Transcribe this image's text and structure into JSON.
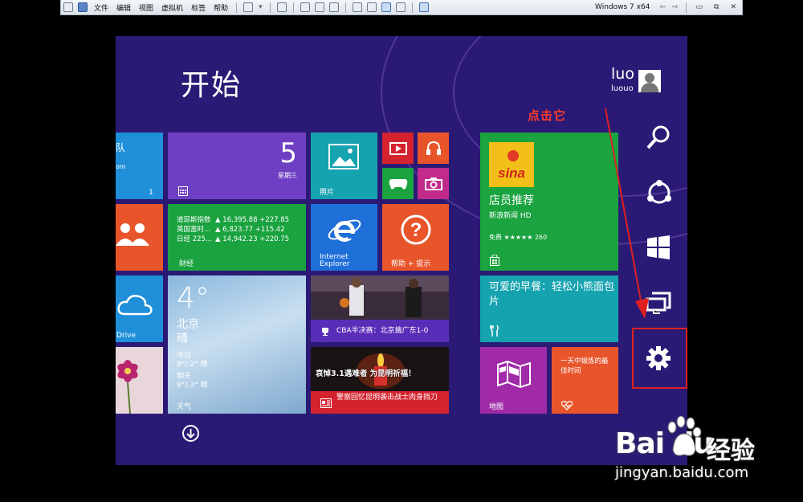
{
  "vm_toolbar": {
    "menus": [
      "文件",
      "编辑",
      "视图",
      "虚拟机",
      "标签",
      "帮助"
    ],
    "vm_name": "Windows 7 x64"
  },
  "start": {
    "title": "开始",
    "user": {
      "name": "luo",
      "account": "luouo"
    }
  },
  "tiles": {
    "left_partial_1": {
      "text": "队",
      "sub": "om",
      "count": "1"
    },
    "calendar": {
      "day": "5",
      "weekday": "星期三"
    },
    "photos": {
      "label": "照片"
    },
    "finance": {
      "label": "财经",
      "rows": [
        {
          "name": "道琼斯指数",
          "value": "▲ 16,395.88 +227.85"
        },
        {
          "name": "英国富时...",
          "value": "▲ 6,823.77 +115.42"
        },
        {
          "name": "日经 225...",
          "value": "▲ 14,942.23 +220.75"
        }
      ]
    },
    "ie": {
      "label": "Internet Explorer"
    },
    "help": {
      "label": "帮助 + 提示"
    },
    "onedrive": {
      "label": "Drive"
    },
    "weather": {
      "temp": "4°",
      "city": "北京",
      "condition": "晴",
      "today_label": "今日",
      "today_value": "9°/-2° 晴",
      "tomorrow_label": "明天",
      "tomorrow_value": "8°/-3° 晴",
      "label": "天气"
    },
    "news_cba": {
      "text": "CBA半决赛：北京擒广东1-0"
    },
    "news_candle": {
      "overlay": "哀悼3.1遇难者 为昆明祈福！",
      "text": "警察回忆昆明袭击战士肉身挡刀"
    },
    "store": {
      "title": "店员推荐",
      "sub": "新浪新闻 HD",
      "rating": "免费 ★★★★★ 260",
      "logo": "sina"
    },
    "food": {
      "title": "可爱的早餐：轻松小熊面包片"
    },
    "maps": {
      "label": "地图"
    },
    "health": {
      "text": "一天中锻炼的最佳时间"
    }
  },
  "annotation": {
    "text": "点击它"
  },
  "watermark": {
    "logo": "Bai du",
    "brand": "经验",
    "url": "jingyan.baidu.com"
  },
  "icons": [
    "search-icon",
    "share-icon",
    "start-icon",
    "devices-icon",
    "settings-icon"
  ],
  "colors": {
    "bg": "#2b1a75",
    "blue": "#1f8fd9",
    "purple": "#6f3fc3",
    "green": "#1aa33f",
    "teal": "#16a3b0",
    "orange": "#e8552b",
    "red": "#d4232e",
    "magenta": "#a02aa8",
    "highlight": "#e02020"
  }
}
